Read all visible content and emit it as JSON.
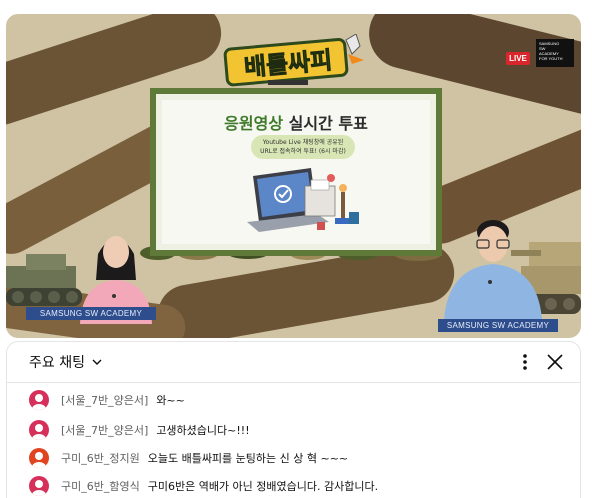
{
  "video": {
    "live_label": "LIVE",
    "title_logo_text": "배틀싸피",
    "corner_logo_text": "SAMSUNG SW ACADEMY FOR YOUTH",
    "board": {
      "title_green": "응원영상",
      "title_rest": "실시간 투표",
      "pill_line1": "Youtube Live 채팅창에 공유된",
      "pill_line2": "URL로 접속하여 투표! (6시 마감)"
    },
    "nameplate_left": "SAMSUNG SW ACADEMY",
    "nameplate_right": "SAMSUNG SW ACADEMY"
  },
  "chat": {
    "header_title": "주요 채팅",
    "icons": [
      "chevron-down-icon",
      "more-vert-icon",
      "close-icon"
    ],
    "messages": [
      {
        "author": "[서울_7반_양은서]",
        "text": "와~~",
        "avatar_color": "#d62f5a"
      },
      {
        "author": "[서울_7반_양은서]",
        "text": "고생하셨습니다~!!!",
        "avatar_color": "#d62f5a"
      },
      {
        "author": "구미_6반_정지원",
        "text": "오늘도 배틀싸피를 눈팅하는 신 상 혁 ~~~",
        "avatar_color": "#e0451f"
      },
      {
        "author": "구미_6반_함영식",
        "text": "구미6반은 역배가 아닌 정배였습니다. 감사합니다.",
        "avatar_color": "#d62f5a"
      }
    ]
  }
}
